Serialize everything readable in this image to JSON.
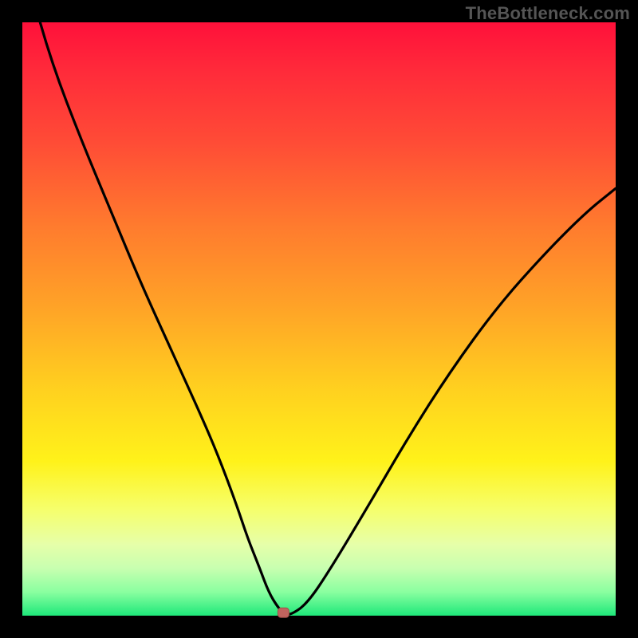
{
  "watermark": "TheBottleneck.com",
  "colors": {
    "frame": "#000000",
    "gradient_top": "#ff103a",
    "gradient_mid": "#fff21a",
    "gradient_bottom": "#1ee87a",
    "curve": "#000000",
    "marker": "#c0635e"
  },
  "chart_data": {
    "type": "line",
    "title": "",
    "xlabel": "",
    "ylabel": "",
    "xlim": [
      0,
      100
    ],
    "ylim": [
      0,
      100
    ],
    "grid": false,
    "legend": false,
    "series": [
      {
        "name": "bottleneck-curve",
        "x": [
          3,
          5,
          10,
          15,
          20,
          25,
          30,
          33,
          36,
          38,
          40,
          41.5,
          43,
          44,
          45,
          48,
          52,
          58,
          65,
          72,
          80,
          88,
          95,
          100
        ],
        "y": [
          100,
          93,
          80,
          68,
          56,
          45,
          34,
          27,
          19,
          13,
          8,
          4,
          1.5,
          0.5,
          0,
          2,
          8,
          18,
          30,
          41,
          52,
          61,
          68,
          72
        ]
      }
    ],
    "annotations": [
      {
        "name": "optimal-marker",
        "x": 44,
        "y": 0.5
      }
    ]
  }
}
